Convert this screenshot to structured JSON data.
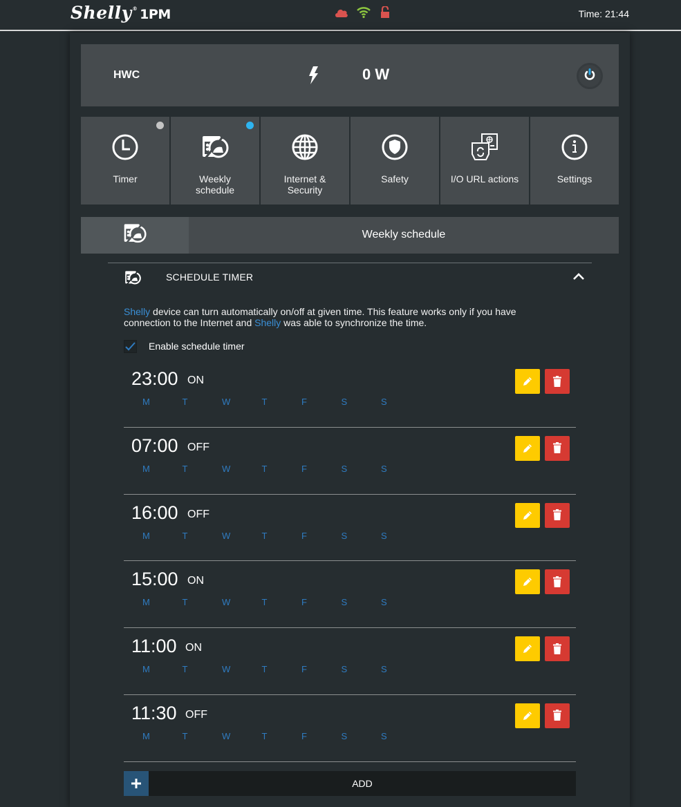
{
  "header": {
    "brand": "Shelly",
    "brand_mark": "®",
    "model": "1PM",
    "status_icons": [
      {
        "name": "cloud-icon",
        "color": "#d9534f"
      },
      {
        "name": "wifi-icon",
        "color": "#8dc63f"
      },
      {
        "name": "unlock-icon",
        "color": "#d9534f"
      }
    ],
    "time_label": "Time: 21:44"
  },
  "device": {
    "name": "HWC",
    "power_icon": "bolt-icon",
    "power_value": "0 W",
    "toggle_icon": "power-icon",
    "toggle_accent": "#2ba9e8"
  },
  "nav": {
    "tiles": [
      {
        "label": "Timer",
        "icon": "clock-icon",
        "dot_color": "#c4c4c4"
      },
      {
        "label": "Weekly schedule",
        "icon": "schedule-icon",
        "dot_color": "#2eb4f0"
      },
      {
        "label": "Internet & Security",
        "icon": "globe-icon"
      },
      {
        "label": "Safety",
        "icon": "shield-icon"
      },
      {
        "label": "I/O URL actions",
        "icon": "url-actions-icon"
      },
      {
        "label": "Settings",
        "icon": "info-icon"
      }
    ]
  },
  "section": {
    "title": "Weekly schedule",
    "icon": "schedule-icon"
  },
  "schedule_timer": {
    "title": "SCHEDULE TIMER",
    "description": {
      "brand": "Shelly",
      "part1": " device can turn automatically on/off at given time. This feature works only if you have connection to the Internet and ",
      "brand2": "Shelly",
      "part2": " was able to synchronize the time."
    },
    "enable_label": "Enable schedule timer",
    "enabled": true,
    "day_labels": [
      "M",
      "T",
      "W",
      "T",
      "F",
      "S",
      "S"
    ],
    "entries": [
      {
        "time": "23:00",
        "action": "ON"
      },
      {
        "time": "07:00",
        "action": "OFF"
      },
      {
        "time": "16:00",
        "action": "OFF"
      },
      {
        "time": "15:00",
        "action": "ON"
      },
      {
        "time": "11:00",
        "action": "ON"
      },
      {
        "time": "11:30",
        "action": "OFF"
      }
    ],
    "add_label": "ADD"
  },
  "colors": {
    "edit": "#fecb00",
    "delete": "#d63a32",
    "day_text": "#2f7bc0",
    "add_icon_bg": "#285477"
  }
}
